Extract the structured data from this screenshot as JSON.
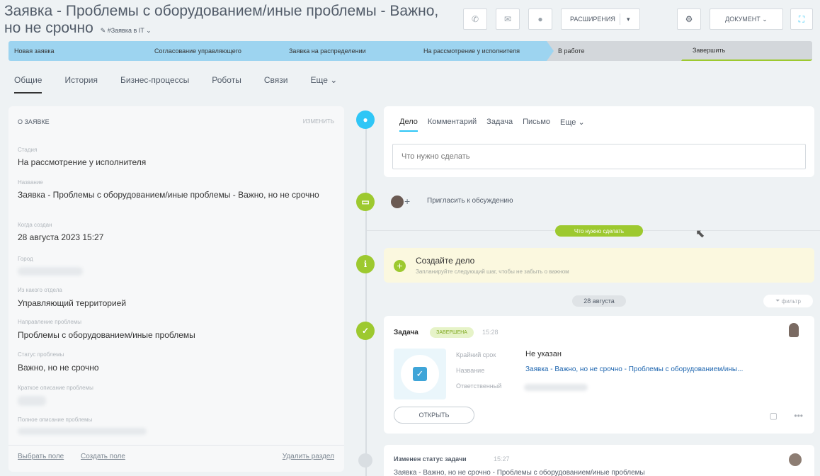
{
  "header": {
    "title": "Заявка - Проблемы с оборудованием/иные проблемы - Важно, но не срочно",
    "category": "Заявка в IT",
    "buttons": {
      "extensions": "РАСШИРЕНИЯ",
      "document": "ДОКУМЕНТ"
    }
  },
  "stages": [
    {
      "label": "Новая заявка",
      "color": "#9dd4f0"
    },
    {
      "label": "Согласование управляющего",
      "color": "#9dd4f0"
    },
    {
      "label": "Заявка на распределении",
      "color": "#9dd4f0"
    },
    {
      "label": "На рассмотрение у исполнителя",
      "color": "#9dd4f0"
    },
    {
      "label": "В работе",
      "color": "#d3d7db"
    },
    {
      "label": "Завершить",
      "color": "#d3d7db"
    }
  ],
  "tabs": [
    "Общие",
    "История",
    "Бизнес-процессы",
    "Роботы",
    "Связи",
    "Еще"
  ],
  "left_panel": {
    "header": "О ЗАЯВКЕ",
    "edit": "изменить",
    "fields": [
      {
        "label": "Стадия",
        "value": "На рассмотрение у исполнителя"
      },
      {
        "label": "Название",
        "value": "Заявка - Проблемы с оборудованием/иные проблемы - Важно, но не срочно"
      },
      {
        "label": "Когда создан",
        "value": "28 августа 2023 15:27"
      },
      {
        "label": "Город",
        "value": ""
      },
      {
        "label": "Из какого отдела",
        "value": "Управляющий территорией"
      },
      {
        "label": "Направление проблемы",
        "value": "Проблемы с оборудованием/иные проблемы"
      },
      {
        "label": "Статус проблемы",
        "value": "Важно, но не срочно"
      },
      {
        "label": "Краткое описание проблемы",
        "value": ""
      },
      {
        "label": "Полное описание проблемы",
        "value": ""
      }
    ],
    "footer": {
      "select_field": "Выбрать поле",
      "create_field": "Создать поле",
      "delete_section": "Удалить раздел"
    }
  },
  "feed": {
    "tabs": [
      "Дело",
      "Комментарий",
      "Задача",
      "Письмо",
      "Еще"
    ],
    "input_placeholder": "Что нужно сделать",
    "invite": "Пригласить к обсуждению",
    "todo_pill": "Что нужно сделать",
    "create_title": "Создайте дело",
    "create_sub": "Запланируйте следующий шаг, чтобы не забыть о важном",
    "date_pill": "28 августа",
    "filter": "фильтр",
    "task": {
      "title": "Задача",
      "badge": "завершена",
      "time": "15:28",
      "deadline_label": "Крайний срок",
      "deadline_value": "Не указан",
      "name_label": "Название",
      "name_value": "Заявка - Важно, но не срочно - Проблемы с оборудованием/ины...",
      "resp_label": "Ответственный",
      "open": "ОТКРЫТЬ"
    },
    "status_change": {
      "title": "Изменен статус задачи",
      "time": "15:27",
      "text": "Заявка - Важно, но не срочно - Проблемы с оборудованием/иные проблемы"
    }
  },
  "colors": {
    "accent_green": "#9dc92f",
    "stage_done": "#9dd4f0",
    "stage_todo": "#d3d7db",
    "timeline_blue": "#2fc6f6"
  }
}
